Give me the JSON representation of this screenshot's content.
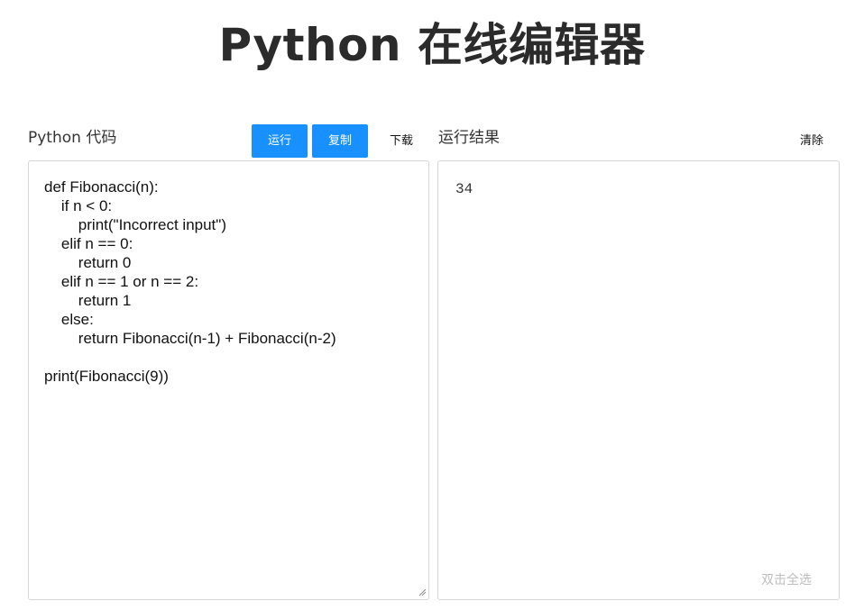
{
  "header": {
    "title": "Python 在线编辑器"
  },
  "editor": {
    "label": "Python 代码",
    "run_label": "运行",
    "copy_label": "复制",
    "download_label": "下载",
    "code_lines": [
      "def Fibonacci(n):",
      "\tif n < 0:",
      "\t\tprint(\"Incorrect input\")",
      "\telif n == 0:",
      "\t\treturn 0",
      "\telif n == 1 or n == 2:",
      "\t\treturn 1",
      "\telse:",
      "\t\treturn Fibonacci(n-1) + Fibonacci(n-2)",
      "",
      "print(Fibonacci(9))"
    ]
  },
  "output": {
    "label": "运行结果",
    "clear_label": "清除",
    "result": "34",
    "select_all_hint": "双击全选"
  },
  "colors": {
    "primary": "#1890ff",
    "border": "#d6d6d6",
    "hint": "#bdbdbd"
  }
}
